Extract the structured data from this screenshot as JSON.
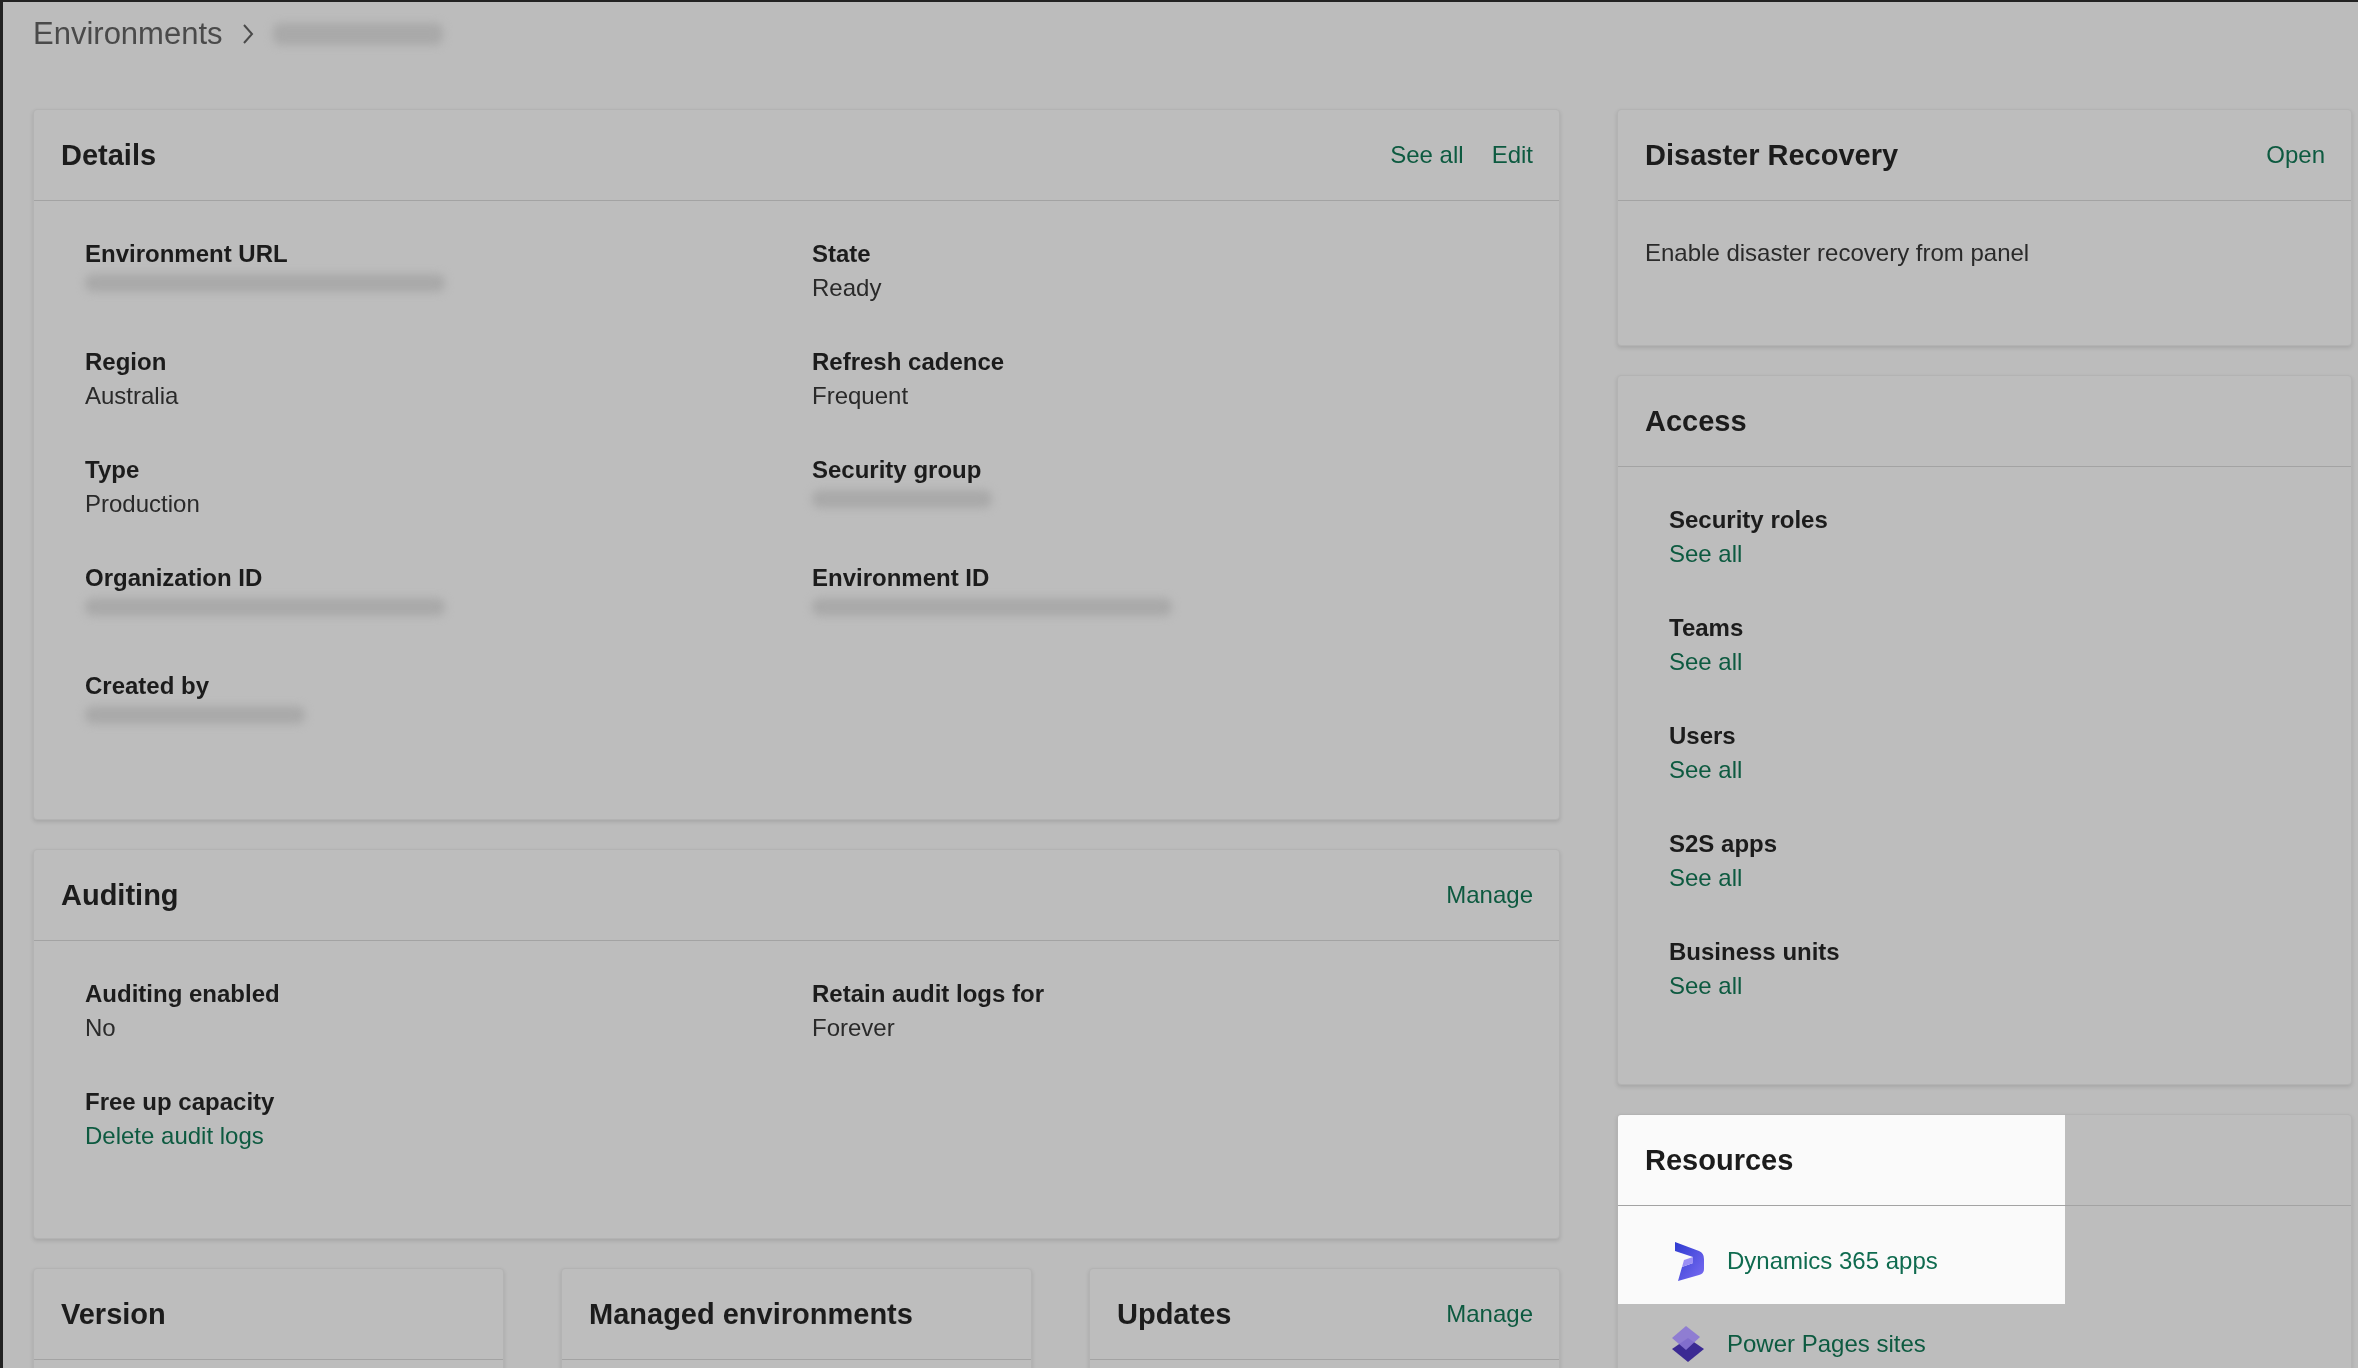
{
  "breadcrumb": {
    "root": "Environments",
    "current_redacted": true
  },
  "details": {
    "title": "Details",
    "actions": [
      "See all",
      "Edit"
    ],
    "fields": [
      {
        "label": "Environment URL",
        "kind": "redacted"
      },
      {
        "label": "State",
        "kind": "text",
        "value": "Ready"
      },
      {
        "label": "Region",
        "kind": "text",
        "value": "Australia"
      },
      {
        "label": "Refresh cadence",
        "kind": "text",
        "value": "Frequent"
      },
      {
        "label": "Type",
        "kind": "text",
        "value": "Production"
      },
      {
        "label": "Security group",
        "kind": "redacted"
      },
      {
        "label": "Organization ID",
        "kind": "redacted"
      },
      {
        "label": "Environment ID",
        "kind": "redacted"
      },
      {
        "label": "Created by",
        "kind": "redacted"
      }
    ]
  },
  "auditing": {
    "title": "Auditing",
    "actions": [
      "Manage"
    ],
    "fields": [
      {
        "label": "Auditing enabled",
        "kind": "text",
        "value": "No"
      },
      {
        "label": "Retain audit logs for",
        "kind": "text",
        "value": "Forever"
      },
      {
        "label": "Free up capacity",
        "kind": "link",
        "value": "Delete audit logs"
      }
    ]
  },
  "bottom_cards": [
    {
      "title": "Version"
    },
    {
      "title": "Managed environments"
    },
    {
      "title": "Updates",
      "actions": [
        "Manage"
      ]
    }
  ],
  "disaster_recovery": {
    "title": "Disaster Recovery",
    "actions": [
      "Open"
    ],
    "text": "Enable disaster recovery from panel"
  },
  "access": {
    "title": "Access",
    "items": [
      {
        "label": "Security roles",
        "link": "See all"
      },
      {
        "label": "Teams",
        "link": "See all"
      },
      {
        "label": "Users",
        "link": "See all"
      },
      {
        "label": "S2S apps",
        "link": "See all"
      },
      {
        "label": "Business units",
        "link": "See all"
      }
    ]
  },
  "resources": {
    "title": "Resources",
    "highlighted": true,
    "items": [
      {
        "label": "Dynamics 365 apps",
        "kind": "dynamics",
        "highlighted": true
      },
      {
        "label": "Power Pages sites",
        "kind": "pages",
        "highlighted": false
      }
    ]
  }
}
